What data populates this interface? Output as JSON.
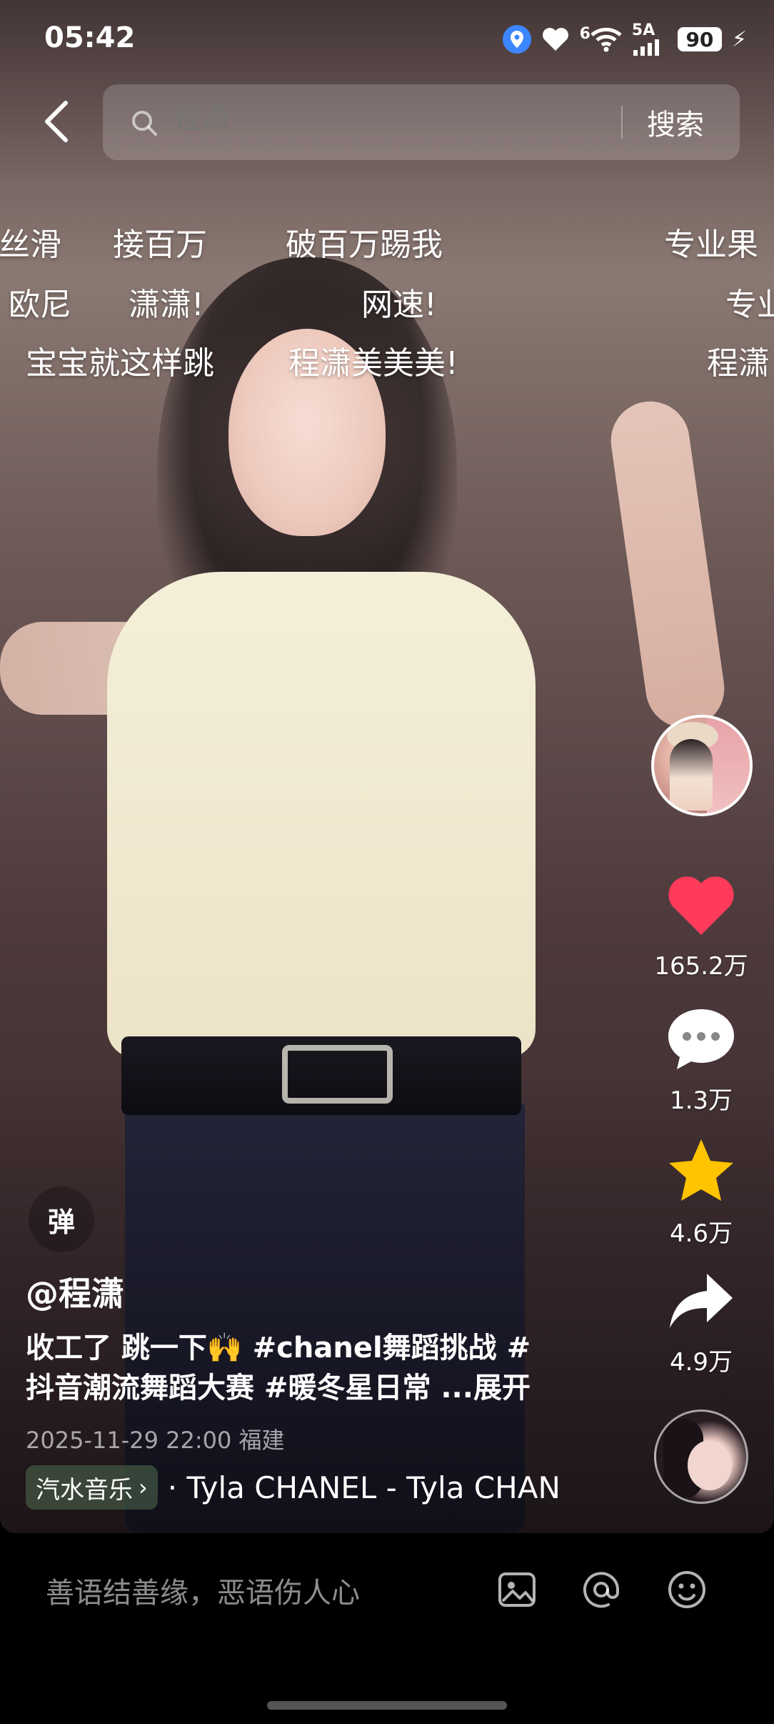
{
  "status_bar": {
    "time": "05:42",
    "network_label": "6",
    "signal_label": "5A",
    "battery": "90"
  },
  "search": {
    "placeholder": "程潇",
    "button_label": "搜索"
  },
  "danmaku": [
    {
      "text": "丝滑"
    },
    {
      "text": "接百万"
    },
    {
      "text": "破百万踢我"
    },
    {
      "text": "专业果"
    },
    {
      "text": "欧尼"
    },
    {
      "text": "潇潇!"
    },
    {
      "text": "网速!"
    },
    {
      "text": "专业"
    },
    {
      "text": "宝宝就这样跳"
    },
    {
      "text": "程潇美美美!"
    },
    {
      "text": "程潇"
    }
  ],
  "actions": {
    "likes": "165.2万",
    "comments": "1.3万",
    "favorites": "4.6万",
    "shares": "4.9万"
  },
  "danmu_button": "弹",
  "post": {
    "author": "@程潇",
    "description_line1": "收工了 跳一下🙌 #chanel舞蹈挑战 #",
    "description_line2": "抖音潮流舞蹈大赛 #暖冬星日常 ...展开",
    "date_location": "2025-11-29 22:00 福建",
    "music_tag": "汽水音乐",
    "music_text": "· Tyla  CHANEL - Tyla  CHAN"
  },
  "comment_bar": {
    "placeholder": "善语结善缘，恶语伤人心"
  },
  "colors": {
    "like": "#ff3b5c",
    "favorite": "#ffc300",
    "location": "#3c86ff"
  }
}
